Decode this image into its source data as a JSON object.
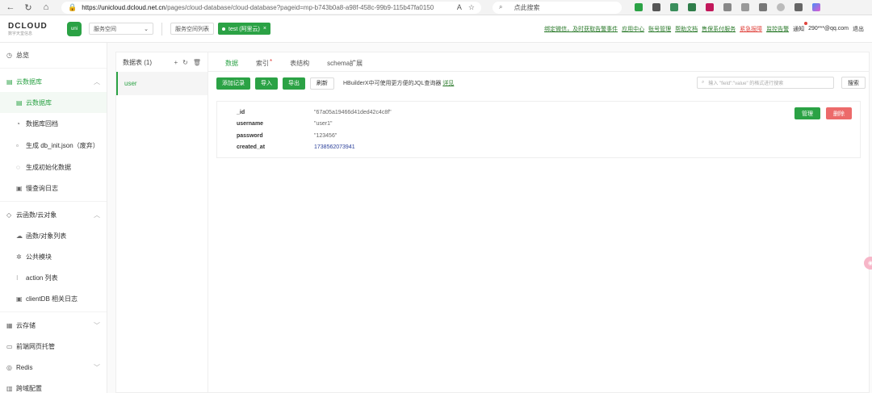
{
  "browser": {
    "url_host": "https://unicloud.dcloud.net.cn",
    "url_path": "/pages/cloud-database/cloud-database?pageid=mp-b743b0a8-a98f-458c-99b9-115b47fa0150",
    "search_placeholder": "点此搜索"
  },
  "header": {
    "logo_text": "DCLOUD",
    "logo_sub": "数字天堂信息",
    "uni_badge": "uni",
    "space_select": "服务空间",
    "space_list": "服务空间列表",
    "env_tag": "test (阿里云)",
    "links": {
      "wechat": "绑定微信，及时获取告警事件",
      "app_center": "应用中心",
      "account": "账号管理",
      "help": "帮助文档",
      "vip": "售保系付服务",
      "urgent": "紧急报障",
      "monitor": "监控告警",
      "notify": "通知",
      "user": "290***@qq.com",
      "logout": "退出"
    }
  },
  "sidebar": {
    "items": [
      {
        "label": "总览",
        "icon": "overview-icon"
      },
      {
        "label": "云数据库",
        "icon": "database-icon"
      },
      {
        "label": "云数据库",
        "icon": "table-icon"
      },
      {
        "label": "数据库回档",
        "icon": "rollback-icon"
      },
      {
        "label": "生成 db_init.json（废弃）",
        "icon": "file-icon"
      },
      {
        "label": "生成初始化数据",
        "icon": "init-icon"
      },
      {
        "label": "慢查询日志",
        "icon": "log-icon"
      },
      {
        "label": "云函数/云对象",
        "icon": "function-icon"
      },
      {
        "label": "函数/对象列表",
        "icon": "cloud-icon"
      },
      {
        "label": "公共模块",
        "icon": "module-icon"
      },
      {
        "label": "action 列表",
        "icon": "action-icon"
      },
      {
        "label": "clientDB 相关日志",
        "icon": "log-icon"
      },
      {
        "label": "云存储",
        "icon": "storage-icon"
      },
      {
        "label": "前端网页托管",
        "icon": "web-icon"
      },
      {
        "label": "Redis",
        "icon": "redis-icon"
      },
      {
        "label": "跨域配置",
        "icon": "cors-icon"
      }
    ]
  },
  "tables": {
    "title": "数据表 (1)",
    "items": [
      "user"
    ]
  },
  "tabs": [
    "数据",
    "索引",
    "表结构",
    "schema扩展"
  ],
  "toolbar": {
    "add": "添加记录",
    "import": "导入",
    "export": "导出",
    "refresh": "刷新",
    "hint": "HBuilderX中可使用更方便的JQL查询器",
    "hint_link": "详见",
    "search_placeholder": "输入 \"field\":\"value\" 的格式进行搜索",
    "search_btn": "搜索"
  },
  "record": {
    "fields": [
      {
        "key": "_id",
        "value": "\"67a05a19466d41ded42c4c8f\""
      },
      {
        "key": "username",
        "value": "\"user1\""
      },
      {
        "key": "password",
        "value": "\"123456\""
      },
      {
        "key": "created_at",
        "value": "1738562073941"
      }
    ],
    "manage": "管理",
    "delete": "删除"
  },
  "colors": {
    "accent": "#2ba245",
    "danger": "#ec6a6a",
    "number": "#2a3f9a"
  }
}
